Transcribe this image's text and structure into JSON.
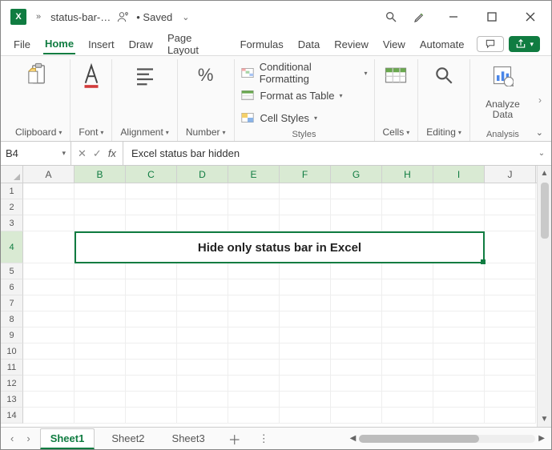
{
  "titlebar": {
    "filename": "status-bar-…",
    "save_state": "• Saved",
    "excel_letter": "X"
  },
  "tabs": {
    "items": [
      "File",
      "Home",
      "Insert",
      "Draw",
      "Page Layout",
      "Formulas",
      "Data",
      "Review",
      "View",
      "Automate"
    ],
    "active_index": 1
  },
  "ribbon": {
    "clipboard": {
      "label": "Clipboard"
    },
    "font": {
      "label": "Font"
    },
    "alignment": {
      "label": "Alignment"
    },
    "number": {
      "label": "Number"
    },
    "styles": {
      "conditional": "Conditional Formatting",
      "table": "Format as Table",
      "cellstyles": "Cell Styles",
      "group_label": "Styles"
    },
    "cells": {
      "label": "Cells"
    },
    "editing": {
      "label": "Editing"
    },
    "analyze": {
      "label": "Analyze Data",
      "group_label": "Analysis"
    }
  },
  "fxbar": {
    "name_box": "B4",
    "formula": "Excel status bar hidden",
    "fx_label": "fx"
  },
  "grid": {
    "columns": [
      "A",
      "B",
      "C",
      "D",
      "E",
      "F",
      "G",
      "H",
      "I",
      "J"
    ],
    "selected_cols": [
      "B",
      "C",
      "D",
      "E",
      "F",
      "G",
      "H",
      "I"
    ],
    "rows": [
      1,
      2,
      3,
      4,
      5,
      6,
      7,
      8,
      9,
      10,
      11,
      12,
      13,
      14
    ],
    "selected_row": 4,
    "merged_text": "Hide only status bar in Excel"
  },
  "sheets": {
    "items": [
      "Sheet1",
      "Sheet2",
      "Sheet3"
    ],
    "active_index": 0
  }
}
